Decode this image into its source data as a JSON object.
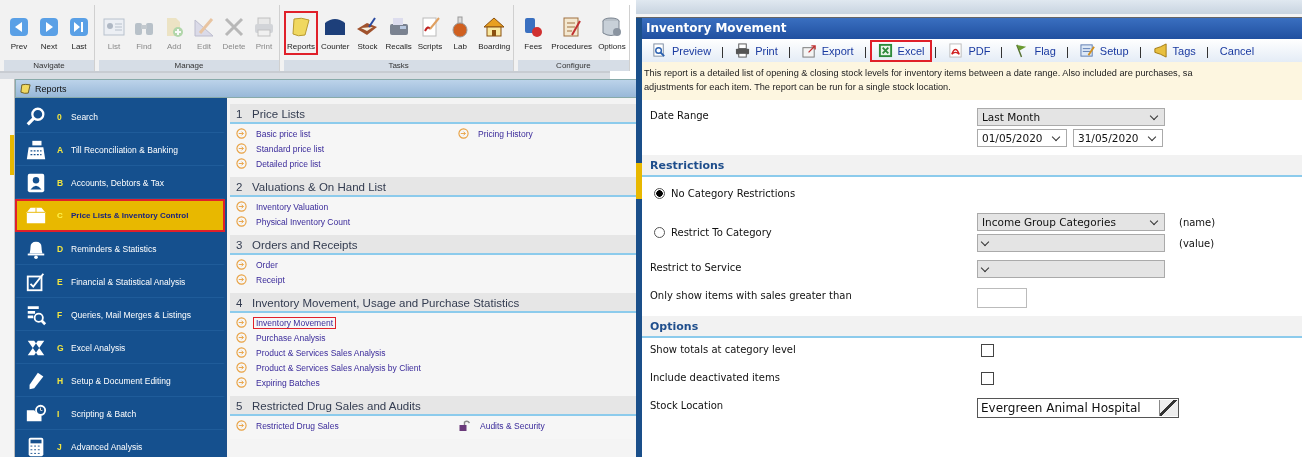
{
  "ribbon": {
    "groups": [
      {
        "label": "Navigate",
        "buttons": [
          {
            "label": "Prev",
            "disabled": false,
            "highlighted": false
          },
          {
            "label": "Next",
            "disabled": false,
            "highlighted": false
          },
          {
            "label": "Last",
            "disabled": false,
            "highlighted": false
          }
        ]
      },
      {
        "label": "Manage",
        "buttons": [
          {
            "label": "List",
            "disabled": true,
            "highlighted": false
          },
          {
            "label": "Find",
            "disabled": true,
            "highlighted": false
          },
          {
            "label": "Add",
            "disabled": true,
            "highlighted": false
          },
          {
            "label": "Edit",
            "disabled": true,
            "highlighted": false
          },
          {
            "label": "Delete",
            "disabled": true,
            "highlighted": false
          },
          {
            "label": "Print",
            "disabled": true,
            "highlighted": false
          }
        ]
      },
      {
        "label": "Tasks",
        "buttons": [
          {
            "label": "Reports",
            "disabled": false,
            "highlighted": true
          },
          {
            "label": "Counter",
            "disabled": false,
            "highlighted": false
          },
          {
            "label": "Stock",
            "disabled": false,
            "highlighted": false
          },
          {
            "label": "Recalls",
            "disabled": false,
            "highlighted": false
          },
          {
            "label": "Scripts",
            "disabled": false,
            "highlighted": false
          },
          {
            "label": "Lab",
            "disabled": false,
            "highlighted": false
          },
          {
            "label": "Boarding",
            "disabled": false,
            "highlighted": false
          }
        ]
      },
      {
        "label": "Configure",
        "buttons": [
          {
            "label": "Fees",
            "disabled": false,
            "highlighted": false
          },
          {
            "label": "Procedures",
            "disabled": false,
            "highlighted": false
          },
          {
            "label": "Options",
            "disabled": false,
            "highlighted": false
          }
        ]
      }
    ]
  },
  "window_tab": {
    "title": "Reports"
  },
  "sidebar": {
    "items": [
      {
        "key": "0",
        "label": "Search",
        "selected": false,
        "highlighted": false
      },
      {
        "key": "A",
        "label": "Till Reconciliation & Banking",
        "selected": false,
        "highlighted": false
      },
      {
        "key": "B",
        "label": "Accounts, Debtors & Tax",
        "selected": false,
        "highlighted": false
      },
      {
        "key": "C",
        "label": "Price Lists & Inventory Control",
        "selected": true,
        "highlighted": true
      },
      {
        "key": "D",
        "label": "Reminders & Statistics",
        "selected": false,
        "highlighted": false
      },
      {
        "key": "E",
        "label": "Financial & Statistical Analysis",
        "selected": false,
        "highlighted": false
      },
      {
        "key": "F",
        "label": "Queries, Mail Merges & Listings",
        "selected": false,
        "highlighted": false
      },
      {
        "key": "G",
        "label": "Excel Analysis",
        "selected": false,
        "highlighted": false
      },
      {
        "key": "H",
        "label": "Setup & Document Editing",
        "selected": false,
        "highlighted": false
      },
      {
        "key": "I",
        "label": "Scripting & Batch",
        "selected": false,
        "highlighted": false
      },
      {
        "key": "J",
        "label": "Advanced Analysis",
        "selected": false,
        "highlighted": false
      }
    ]
  },
  "sections": [
    {
      "number": "1",
      "title": "Price Lists",
      "columns": [
        [
          {
            "label": "Basic price list",
            "kind": "report",
            "highlighted": false
          },
          {
            "label": "Standard price list",
            "kind": "report",
            "highlighted": false
          },
          {
            "label": "Detailed price list",
            "kind": "report",
            "highlighted": false
          }
        ],
        [
          {
            "label": "Pricing History",
            "kind": "report",
            "highlighted": false
          }
        ]
      ]
    },
    {
      "number": "2",
      "title": "Valuations & On Hand List",
      "columns": [
        [
          {
            "label": "Inventory Valuation",
            "kind": "report",
            "highlighted": false
          },
          {
            "label": "Physical Inventory Count",
            "kind": "report",
            "highlighted": false
          }
        ]
      ]
    },
    {
      "number": "3",
      "title": "Orders and Receipts",
      "columns": [
        [
          {
            "label": "Order",
            "kind": "report",
            "highlighted": false
          },
          {
            "label": "Receipt",
            "kind": "report",
            "highlighted": false
          }
        ]
      ]
    },
    {
      "number": "4",
      "title": "Inventory Movement, Usage and Purchase Statistics",
      "columns": [
        [
          {
            "label": "Inventory Movement",
            "kind": "report",
            "highlighted": true
          },
          {
            "label": "Purchase Analysis",
            "kind": "report",
            "highlighted": false
          },
          {
            "label": "Product & Services Sales Analysis",
            "kind": "report",
            "highlighted": false
          },
          {
            "label": "Product & Services Sales Analysis by Client",
            "kind": "report",
            "highlighted": false
          },
          {
            "label": "Expiring Batches",
            "kind": "report",
            "highlighted": false
          }
        ]
      ]
    },
    {
      "number": "5",
      "title": "Restricted Drug Sales and Audits",
      "columns": [
        [
          {
            "label": "Restricted Drug Sales",
            "kind": "report",
            "highlighted": false
          }
        ],
        [
          {
            "label": "Audits & Security",
            "kind": "secure",
            "highlighted": false
          }
        ]
      ]
    }
  ],
  "report": {
    "title": "Inventory Movement",
    "toolbar": [
      {
        "label": "Preview",
        "highlighted": false
      },
      {
        "label": "Print",
        "highlighted": false
      },
      {
        "label": "Export",
        "highlighted": false
      },
      {
        "label": "Excel",
        "highlighted": true
      },
      {
        "label": "PDF",
        "highlighted": false
      },
      {
        "label": "Flag",
        "highlighted": false
      },
      {
        "label": "Setup",
        "highlighted": false
      },
      {
        "label": "Tags",
        "highlighted": false
      },
      {
        "label": "Cancel",
        "highlighted": false
      }
    ],
    "description": [
      "This report is a detailed list of opening & closing stock levels for inventory items between a date range. Also included are purchases, sa",
      "adjustments for each item. The report can be run for a single stock location."
    ],
    "date_range": {
      "label": "Date Range",
      "preset": "Last Month",
      "from": "01/05/2020",
      "to": "31/05/2020"
    },
    "restrictions": {
      "title": "Restrictions",
      "options": [
        {
          "label": "No Category Restrictions",
          "selected": true
        },
        {
          "label": "Restrict To Category",
          "selected": false
        }
      ],
      "category_name": "Income Group Categories",
      "name_hint": "(name)",
      "value_hint": "(value)",
      "service_label": "Restrict to Service",
      "sales_label": "Only show items with sales greater than"
    },
    "options": {
      "title": "Options",
      "checkboxes": [
        {
          "label": "Show totals at category level",
          "checked": false
        },
        {
          "label": "Include deactivated items",
          "checked": false
        }
      ],
      "stock_location": {
        "label": "Stock Location",
        "value": "Evergreen Animal Hospital"
      }
    }
  }
}
